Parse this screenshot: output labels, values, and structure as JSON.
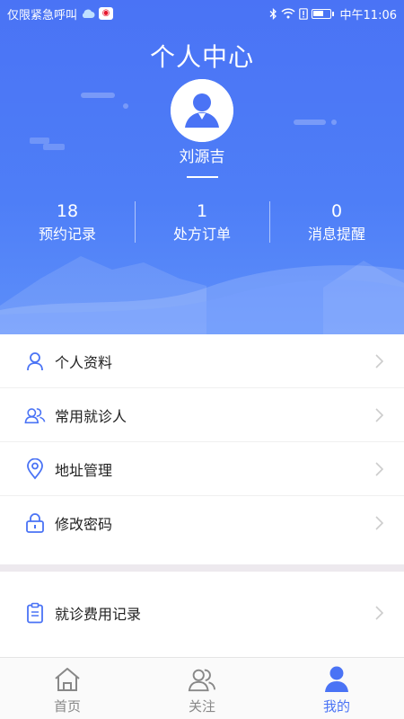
{
  "status_bar": {
    "left_text": "仅限紧急呼叫",
    "time": "中午11:06"
  },
  "header": {
    "title": "个人中心",
    "username": "刘源吉"
  },
  "stats": [
    {
      "value": "18",
      "label": "预约记录"
    },
    {
      "value": "1",
      "label": "处方订单"
    },
    {
      "value": "0",
      "label": "消息提醒"
    }
  ],
  "menu": [
    {
      "label": "个人资料",
      "icon": "person-icon"
    },
    {
      "label": "常用就诊人",
      "icon": "people-icon"
    },
    {
      "label": "地址管理",
      "icon": "location-icon"
    },
    {
      "label": "修改密码",
      "icon": "lock-icon"
    }
  ],
  "menu2": [
    {
      "label": "就诊费用记录",
      "icon": "clipboard-icon"
    }
  ],
  "tabbar": [
    {
      "label": "首页",
      "icon": "home-icon",
      "active": false
    },
    {
      "label": "关注",
      "icon": "follow-icon",
      "active": false
    },
    {
      "label": "我的",
      "icon": "profile-icon",
      "active": true
    }
  ],
  "colors": {
    "accent": "#4a73f5",
    "header_gradient_top": "#4a73f5",
    "header_gradient_bottom": "#5d8ffa",
    "divider": "#ede9ee"
  }
}
